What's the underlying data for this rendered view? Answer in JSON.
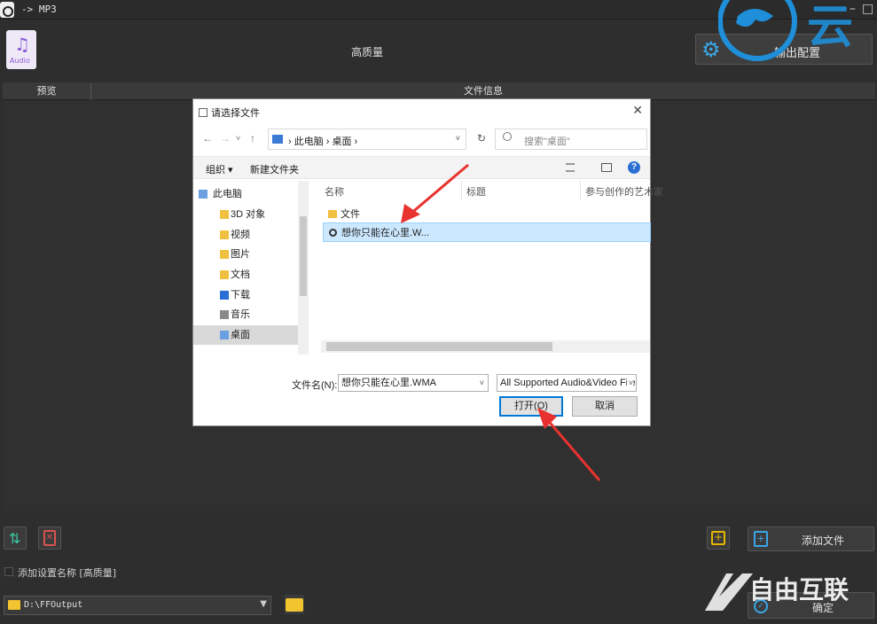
{
  "app": {
    "title": "-> MP3",
    "quality": "高质量",
    "output_config": "输出配置",
    "audio_icon_label": "Audio",
    "columns": {
      "preview": "预览",
      "file_info": "文件信息"
    },
    "add_file": "添加文件",
    "add_setting_name": "添加设置名称 [高质量]",
    "output_path": "D:\\FFOutput",
    "ok": "确定"
  },
  "dialog": {
    "title": "请选择文件",
    "breadcrumb": "› 此电脑 › 桌面 ›",
    "search_placeholder": "搜索\"桌面\"",
    "toolbar": {
      "organize": "组织 ▾",
      "new_folder": "新建文件夹"
    },
    "tree": [
      {
        "label": "此电脑",
        "icon": "pc-icon"
      },
      {
        "label": "3D 对象",
        "icon": "folder-icon"
      },
      {
        "label": "视频",
        "icon": "video-icon"
      },
      {
        "label": "图片",
        "icon": "picture-icon"
      },
      {
        "label": "文档",
        "icon": "document-icon"
      },
      {
        "label": "下载",
        "icon": "download-icon"
      },
      {
        "label": "音乐",
        "icon": "music-icon"
      },
      {
        "label": "桌面",
        "icon": "desktop-icon"
      }
    ],
    "columns": {
      "name": "名称",
      "title": "标题",
      "artist": "参与创作的艺术家"
    },
    "files": [
      {
        "name": "文件",
        "type": "folder"
      },
      {
        "name": "想你只能在心里.W...",
        "type": "audio"
      }
    ],
    "filename_label": "文件名(N):",
    "filename_value": "想你只能在心里.WMA",
    "filetype_value": "All Supported Audio&Video Files",
    "open": "打开(O)",
    "cancel": "取消"
  },
  "watermarks": {
    "top": "云",
    "bottom": "自由互联"
  },
  "colors": {
    "accent": "#3aa6e8",
    "arrow": "#e8322f",
    "folder": "#f2c430"
  }
}
